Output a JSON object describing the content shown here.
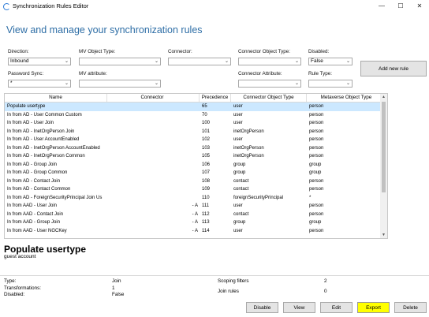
{
  "window": {
    "title": "Synchronization Rules Editor",
    "minimize": "—",
    "maximize": "☐",
    "close": "✕"
  },
  "page_title": "View and manage your synchronization rules",
  "filters": {
    "direction": {
      "label": "Direction:",
      "value": "Inbound"
    },
    "mv_object_type": {
      "label": "MV Object Type:",
      "value": ""
    },
    "connector": {
      "label": "Connector:",
      "value": ""
    },
    "connector_object_type": {
      "label": "Connector Object Type:",
      "value": ""
    },
    "disabled": {
      "label": "Disabled:",
      "value": "False"
    },
    "password_sync": {
      "label": "Password Sync:",
      "value": "*"
    },
    "mv_attribute": {
      "label": "MV attribute:",
      "value": ""
    },
    "connector_attribute": {
      "label": "Connector Attribute:",
      "value": ""
    },
    "rule_type": {
      "label": "Rule Type:",
      "value": ""
    }
  },
  "add_rule_button": "Add new rule",
  "grid": {
    "columns": [
      "Name",
      "Connector",
      "Precedence",
      "Connector Object Type",
      "Metaverse Object Type"
    ],
    "rows": [
      {
        "name": "Populate usertype",
        "connector": "",
        "precedence": "65",
        "cot": "user",
        "mot": "person"
      },
      {
        "name": "In from AD - User Common Custom",
        "connector": "",
        "precedence": "70",
        "cot": "user",
        "mot": "person"
      },
      {
        "name": "In from AD - User Join",
        "connector": "",
        "precedence": "100",
        "cot": "user",
        "mot": "person"
      },
      {
        "name": "In from AD - InetOrgPerson Join",
        "connector": "",
        "precedence": "101",
        "cot": "inetOrgPerson",
        "mot": "person"
      },
      {
        "name": "In from AD - User AccountEnabled",
        "connector": "",
        "precedence": "102",
        "cot": "user",
        "mot": "person"
      },
      {
        "name": "In from AD - InetOrgPerson AccountEnabled",
        "connector": "",
        "precedence": "103",
        "cot": "inetOrgPerson",
        "mot": "person"
      },
      {
        "name": "In from AD - InetOrgPerson Common",
        "connector": "",
        "precedence": "105",
        "cot": "inetOrgPerson",
        "mot": "person"
      },
      {
        "name": "In from AD - Group Join",
        "connector": "",
        "precedence": "106",
        "cot": "group",
        "mot": "group"
      },
      {
        "name": "In from AD - Group Common",
        "connector": "",
        "precedence": "107",
        "cot": "group",
        "mot": "group"
      },
      {
        "name": "In from AD - Contact Join",
        "connector": "",
        "precedence": "108",
        "cot": "contact",
        "mot": "person"
      },
      {
        "name": "In from AD - Contact Common",
        "connector": "",
        "precedence": "109",
        "cot": "contact",
        "mot": "person"
      },
      {
        "name": "In from AD - ForeignSecurityPrincipal Join Us",
        "connector": "",
        "precedence": "110",
        "cot": "foreignSecurityPrincipal",
        "mot": "*"
      },
      {
        "name": "In from AAD - User Join",
        "connector": "- A",
        "precedence": "111",
        "cot": "user",
        "mot": "person"
      },
      {
        "name": "In from AAD - Contact Join",
        "connector": "- A",
        "precedence": "112",
        "cot": "contact",
        "mot": "person"
      },
      {
        "name": "In from AAD - Group Join",
        "connector": "- A",
        "precedence": "113",
        "cot": "group",
        "mot": "group"
      },
      {
        "name": "In from AAD - User NGCKey",
        "connector": "- A",
        "precedence": "114",
        "cot": "user",
        "mot": "person"
      }
    ]
  },
  "detail": {
    "title": "Populate usertype",
    "description": "guest account",
    "type_label": "Type:",
    "type_value": "Join",
    "transformations_label": "Transformations:",
    "transformations_value": "1",
    "disabled_label": "Disabled:",
    "disabled_value": "False",
    "scoping_label": "Scoping filters",
    "scoping_value": "2",
    "join_label": "Join rules",
    "join_value": "0"
  },
  "actions": {
    "disable": "Disable",
    "view": "View",
    "edit": "Edit",
    "export": "Export",
    "delete": "Delete"
  },
  "colors": {
    "heading": "#2e6ea6",
    "selected_row": "#cce8ff",
    "export_highlight": "#ffff00"
  }
}
